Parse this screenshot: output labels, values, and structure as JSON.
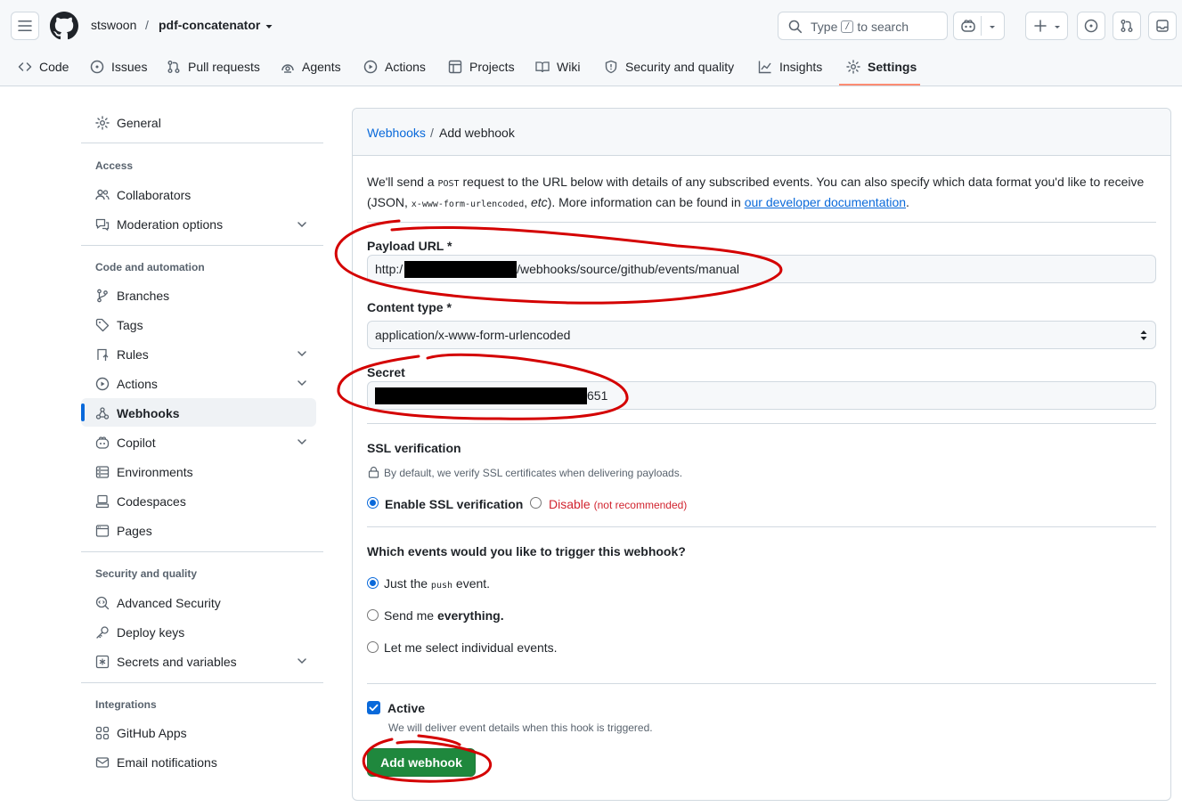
{
  "header": {
    "owner": "stswoon",
    "separator": "/",
    "repo": "pdf-concatenator",
    "search_prefix": "Type",
    "search_key": "/",
    "search_suffix": "to search"
  },
  "tabs": [
    {
      "label": "Code",
      "icon": "code-icon"
    },
    {
      "label": "Issues",
      "icon": "issue-icon"
    },
    {
      "label": "Pull requests",
      "icon": "pull-request-icon"
    },
    {
      "label": "Agents",
      "icon": "agent-icon"
    },
    {
      "label": "Actions",
      "icon": "play-icon"
    },
    {
      "label": "Projects",
      "icon": "table-icon"
    },
    {
      "label": "Wiki",
      "icon": "book-icon"
    },
    {
      "label": "Security and quality",
      "icon": "shield-icon"
    },
    {
      "label": "Insights",
      "icon": "graph-icon"
    },
    {
      "label": "Settings",
      "icon": "gear-icon",
      "selected": true
    }
  ],
  "sidebar": {
    "general": "General",
    "access_heading": "Access",
    "collaborators": "Collaborators",
    "moderation": "Moderation options",
    "code_heading": "Code and automation",
    "branches": "Branches",
    "tags": "Tags",
    "rules": "Rules",
    "actions": "Actions",
    "webhooks": "Webhooks",
    "copilot": "Copilot",
    "environments": "Environments",
    "codespaces": "Codespaces",
    "pages": "Pages",
    "security_heading": "Security and quality",
    "advanced_security": "Advanced Security",
    "deploy_keys": "Deploy keys",
    "secrets": "Secrets and variables",
    "integrations_heading": "Integrations",
    "github_apps": "GitHub Apps",
    "email_notifications": "Email notifications"
  },
  "main": {
    "crumb_link": "Webhooks",
    "crumb_sep": "/",
    "crumb_current": "Add webhook",
    "intro_1": "We'll send a ",
    "intro_post": "POST",
    "intro_2": " request to the URL below with details of any subscribed events. You can also specify which data format you'd like to receive (JSON, ",
    "intro_form": "x-www-form-urlencoded",
    "intro_3": ", ",
    "intro_etc": "etc",
    "intro_4": "). More information can be found in ",
    "intro_link": "our developer documentation",
    "intro_5": ".",
    "payload_label": "Payload URL *",
    "payload_prefix": "http:/",
    "payload_suffix": "/webhooks/source/github/events/manual",
    "content_type_label": "Content type *",
    "content_type_value": "application/x-www-form-urlencoded",
    "secret_label": "Secret",
    "secret_suffix": "651",
    "ssl_label": "SSL verification",
    "ssl_note": "By default, we verify SSL certificates when delivering payloads.",
    "ssl_enable": "Enable SSL verification",
    "ssl_disable": "Disable",
    "ssl_disable_note": "(not recommended)",
    "events_label": "Which events would you like to trigger this webhook?",
    "event_push_1": "Just the ",
    "event_push_code": "push",
    "event_push_2": " event.",
    "event_all_1": "Send me ",
    "event_all_2": "everything.",
    "event_select": "Let me select individual events.",
    "active_label": "Active",
    "active_note": "We will deliver event details when this hook is triggered.",
    "submit": "Add webhook"
  }
}
